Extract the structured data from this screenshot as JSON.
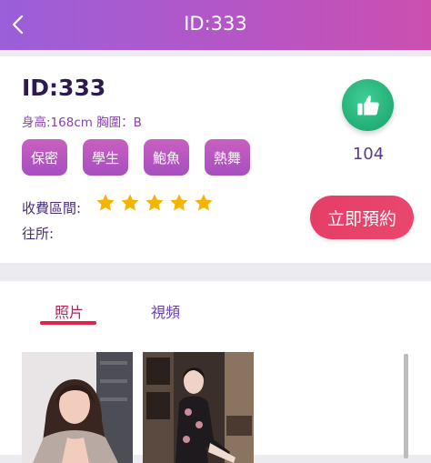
{
  "header": {
    "title": "ID:333",
    "back_icon": "chevron-left-icon"
  },
  "profile": {
    "id_label": "ID:333",
    "stats": "身高:168cm 胸圍：B",
    "tags": [
      "保密",
      "學生",
      "鮑魚",
      "熱舞"
    ],
    "price_label": "收費區間:",
    "rating": 5,
    "rating_max": 5,
    "address_label": "往所:",
    "likes": "104",
    "like_icon": "thumbs-up-icon",
    "book_label": "立即預約"
  },
  "media": {
    "tabs": [
      {
        "label": "照片",
        "active": true
      },
      {
        "label": "視頻",
        "active": false
      }
    ],
    "photos": [
      {
        "name": "photo-1"
      },
      {
        "name": "photo-2"
      }
    ]
  },
  "colors": {
    "header_gradient_start": "#9a5fd9",
    "header_gradient_end": "#cc4fb0",
    "tag_bg": "#b656c0",
    "star": "#f5b400",
    "like_bg": "#1eaa72",
    "book_bg": "#e63e68",
    "active_tab": "#c2195b"
  }
}
